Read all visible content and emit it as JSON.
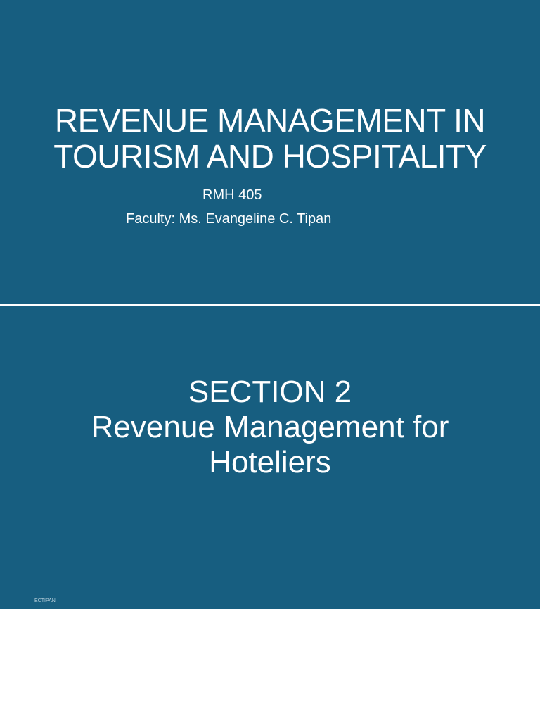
{
  "slide1": {
    "title_line1": "REVENUE MANAGEMENT IN",
    "title_line2": "TOURISM AND HOSPITALITY",
    "course_code": "RMH 405",
    "faculty": "Faculty: Ms. Evangeline C. Tipan"
  },
  "slide2": {
    "line1": "SECTION 2",
    "line2": "Revenue Management for",
    "line3": "Hoteliers",
    "footer": "ECTIPAN"
  },
  "colors": {
    "slide_bg": "#175e80"
  }
}
